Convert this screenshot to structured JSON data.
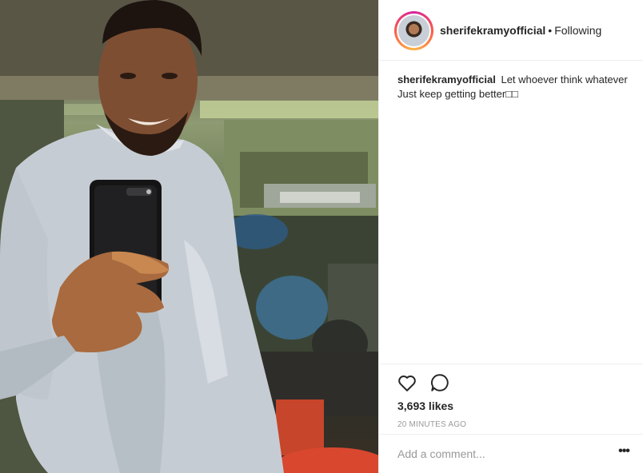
{
  "post": {
    "username": "sherifekramyofficial",
    "separator": "•",
    "follow_status": "Following",
    "caption_text": "Let whoever think whatever Just keep getting better□□",
    "likes": "3,693 likes",
    "timestamp": "20 MINUTES AGO"
  },
  "comment": {
    "placeholder": "Add a comment..."
  },
  "icons": {
    "like": "heart-icon",
    "comment": "comment-bubble-icon",
    "more": "more-options-icon"
  },
  "colors": {
    "text": "#262626",
    "muted": "#999999",
    "divider": "#efefef",
    "story_ring": "#d6249f"
  }
}
